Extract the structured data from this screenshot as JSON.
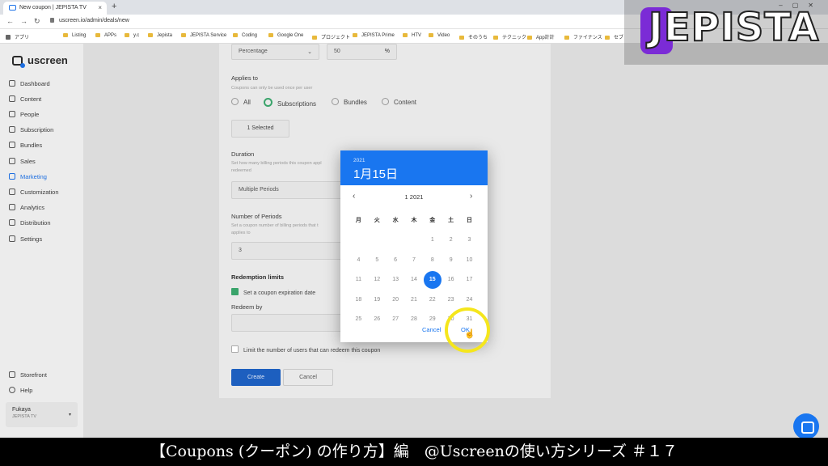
{
  "browser": {
    "tab_title": "New coupon | JEPISTA TV",
    "new_tab": "+",
    "url": "uscreen.io/admin/deals/new",
    "bookmarks": [
      "アプリ",
      "Listing",
      "APPs",
      "y.c",
      "Jepista",
      "JEPISTA Service",
      "Coding",
      "Google One",
      "プロジェクト",
      "JEPISTA Prime",
      "HTV",
      "Video",
      "そのうち",
      "テクニック",
      "App計計",
      "ファイナンス",
      "セブ"
    ]
  },
  "sidebar": {
    "brand": "uscreen",
    "items": [
      {
        "label": "Dashboard",
        "icon": "dashboard-icon"
      },
      {
        "label": "Content",
        "icon": "folder-icon"
      },
      {
        "label": "People",
        "icon": "people-icon"
      },
      {
        "label": "Subscription",
        "icon": "subscription-icon"
      },
      {
        "label": "Bundles",
        "icon": "bundle-icon"
      },
      {
        "label": "Sales",
        "icon": "sales-icon"
      },
      {
        "label": "Marketing",
        "icon": "marketing-icon",
        "active": true
      },
      {
        "label": "Customization",
        "icon": "customization-icon"
      },
      {
        "label": "Analytics",
        "icon": "analytics-icon"
      },
      {
        "label": "Distribution",
        "icon": "distribution-icon"
      },
      {
        "label": "Settings",
        "icon": "gear-icon"
      }
    ],
    "storefront": "Storefront",
    "help": "Help",
    "user": {
      "name": "Fukaya",
      "org": "JEPISTA TV"
    }
  },
  "form": {
    "discount_type": "Percentage",
    "discount_value": "50",
    "discount_unit": "%",
    "applies_to_label": "Applies to",
    "applies_to_hint": "Coupons can only be used once per user",
    "applies_options": [
      "All",
      "Subscriptions",
      "Bundles",
      "Content"
    ],
    "applies_selected": "Subscriptions",
    "selected_button": "1 Selected",
    "duration_label": "Duration",
    "duration_hint_1": "Set how many billing periods this coupon appl",
    "duration_hint_2": "redeemed",
    "duration_value": "Multiple Periods",
    "periods_label": "Number of Periods",
    "periods_hint_1": "Set a coupon number of billing periods that t",
    "periods_hint_2": "applies to",
    "periods_value": "3",
    "redemption_label": "Redemption limits",
    "expiration_check": "Set a coupon expiration date",
    "redeem_by_label": "Redeem by",
    "limit_check": "Limit the number of users that can redeem this coupon",
    "create_button": "Create",
    "cancel_button": "Cancel"
  },
  "datepicker": {
    "year": "2021",
    "selected_date": "1月15日",
    "month_label": "1 2021",
    "weekdays": [
      "月",
      "火",
      "水",
      "木",
      "金",
      "土",
      "日"
    ],
    "weeks": [
      [
        "",
        "",
        "",
        "",
        "1",
        "2",
        "3"
      ],
      [
        "4",
        "5",
        "6",
        "7",
        "8",
        "9",
        "10"
      ],
      [
        "11",
        "12",
        "13",
        "14",
        "15",
        "16",
        "17"
      ],
      [
        "18",
        "19",
        "20",
        "21",
        "22",
        "23",
        "24"
      ],
      [
        "25",
        "26",
        "27",
        "28",
        "29",
        "30",
        "31"
      ]
    ],
    "selected_day": "15",
    "cancel": "Cancel",
    "ok": "OK"
  },
  "overlay": {
    "logo": "JEPISTA",
    "caption": "【Coupons (クーポン) の作り方】編　@Uscreenの使い方シリーズ ＃１７"
  }
}
